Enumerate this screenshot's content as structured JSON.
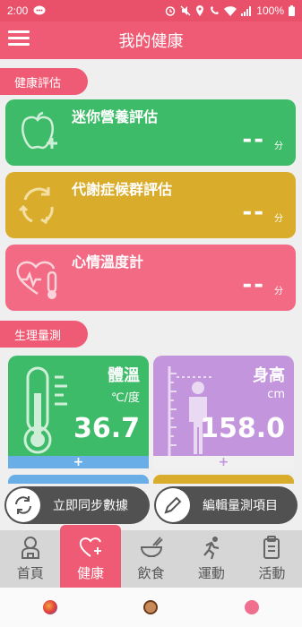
{
  "status_bar": {
    "time": "2:00",
    "battery": "100%"
  },
  "app": {
    "title": "我的健康"
  },
  "sections": {
    "assessment": "健康評估",
    "physiology": "生理量測"
  },
  "assessments": [
    {
      "title": "迷你營養評估",
      "value": "--",
      "unit": "分",
      "color": "#3dbb68",
      "icon": "apple-icon"
    },
    {
      "title": "代謝症候群評估",
      "value": "--",
      "unit": "分",
      "color": "#d9ad2b",
      "icon": "cycle-arrows-icon"
    },
    {
      "title": "心情溫度計",
      "value": "--",
      "unit": "分",
      "color": "#f26a84",
      "icon": "heart-thermometer-icon"
    }
  ],
  "measurements": [
    {
      "title": "體溫",
      "unit": "℃/度",
      "value": "36.7",
      "add": "+",
      "color": "#3dbb68",
      "icon": "thermometer-icon"
    },
    {
      "title": "身高",
      "unit": "cm",
      "value": "158.0",
      "add": "+",
      "color": "#c395dc",
      "icon": "height-person-icon"
    }
  ],
  "actions": {
    "sync": "立即同步數據",
    "edit": "編輯量測項目"
  },
  "nav": [
    {
      "label": "首頁",
      "icon": "home-icon"
    },
    {
      "label": "健康",
      "icon": "heart-plus-icon"
    },
    {
      "label": "飲食",
      "icon": "bowl-icon"
    },
    {
      "label": "運動",
      "icon": "running-icon"
    },
    {
      "label": "活動",
      "icon": "clipboard-icon"
    }
  ]
}
